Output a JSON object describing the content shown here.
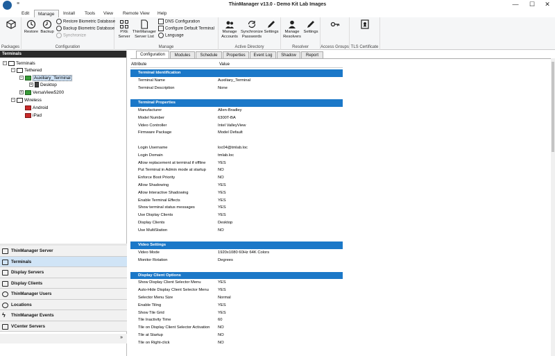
{
  "window": {
    "title": "ThinManager v13.0 - Demo Kit Lab Images",
    "quick_access": "≡",
    "min": "—",
    "max": "☐",
    "close": "✕"
  },
  "menu_tabs": [
    "Edit",
    "Manage",
    "Install",
    "Tools",
    "View",
    "Remote View",
    "Help"
  ],
  "ribbon": {
    "packages": {
      "group": "Packages"
    },
    "configuration": {
      "group": "Configuration",
      "restore": "Restore",
      "backup": "Backup",
      "restore_bio": "Restore Biometric Database",
      "backup_bio": "Backup Biometric Database",
      "synchronize": "Synchronize"
    },
    "manage": {
      "group": "Manage",
      "pxe": "PXE Server",
      "server_list": "ThinManager Server List",
      "dns": "DNS Configuration",
      "default_terminal": "Configure Default Terminal",
      "language": "Language"
    },
    "active_directory": {
      "group": "Active Directory",
      "manage_accounts": "Manage Accounts",
      "sync_passwords": "Synchronize Passwords",
      "settings": "Settings"
    },
    "resolver": {
      "group": "Resolver",
      "manage_resolvers": "Manage Resolvers",
      "settings": "Settings"
    },
    "access_groups": {
      "group": "Access Groups"
    },
    "tls": {
      "group": "TLS Certificate"
    }
  },
  "left_panel": {
    "header": "Terminals",
    "tree": {
      "root": "Terminals",
      "tethered": "Tethered",
      "auxiliary": "Auxiliary_Terminal",
      "desktop": "Desktop",
      "versaview": "VersaView5200",
      "wireless": "Wireless",
      "android": "Android",
      "ipad": "iPad"
    },
    "nav": [
      {
        "label": "ThinManager Server"
      },
      {
        "label": "Terminals"
      },
      {
        "label": "Display Servers"
      },
      {
        "label": "Display Clients"
      },
      {
        "label": "ThinManager Users"
      },
      {
        "label": "Locations"
      },
      {
        "label": "ThinManager Events"
      },
      {
        "label": "VCenter Servers"
      }
    ],
    "collapse": "»"
  },
  "tabs": [
    "Configuration",
    "Modules",
    "Schedule",
    "Properties",
    "Event Log",
    "Shadow",
    "Report"
  ],
  "grid": {
    "col_attribute": "Attribute",
    "col_value": "Value",
    "sections": [
      {
        "title": "Terminal Identification",
        "rows": [
          {
            "a": "Terminal Name",
            "v": "Auxiliary_Terminal"
          },
          {
            "a": "Terminal Description",
            "v": "None"
          },
          {
            "a": "",
            "v": ""
          }
        ]
      },
      {
        "title": "Terminal Properties",
        "rows": [
          {
            "a": "Manufacturer",
            "v": "Allen-Bradley"
          },
          {
            "a": "Model Number",
            "v": "6300T-BA"
          },
          {
            "a": "Video Controller",
            "v": "Intel ValleyView"
          },
          {
            "a": "Firmware Package",
            "v": "Model Default"
          },
          {
            "a": "",
            "v": ""
          },
          {
            "a": "Login Username",
            "v": "loc04@tmlab.loc"
          },
          {
            "a": "Login Domain",
            "v": "tmlab.loc"
          },
          {
            "a": "Allow replacement at terminal if offline",
            "v": "YES"
          },
          {
            "a": "Put Terminal in Admin mode at startup",
            "v": "NO"
          },
          {
            "a": "Enforce Boot Priority",
            "v": "NO"
          },
          {
            "a": "Allow Shadowing",
            "v": "YES"
          },
          {
            "a": "Allow Interactive Shadowing",
            "v": "YES"
          },
          {
            "a": "Enable Terminal Effects",
            "v": "YES"
          },
          {
            "a": "Show terminal status messages",
            "v": "YES"
          },
          {
            "a": "Use Display Clients",
            "v": "YES"
          },
          {
            "a": "Display Clients",
            "v": "Desktop"
          },
          {
            "a": "Use MultiStation",
            "v": "NO"
          },
          {
            "a": "",
            "v": ""
          }
        ]
      },
      {
        "title": "Video Settings",
        "rows": [
          {
            "a": "Video Mode",
            "v": "1920x1080 60Hz 64K Colors"
          },
          {
            "a": "Monitor Rotation",
            "v": " Degrees"
          },
          {
            "a": "",
            "v": ""
          }
        ]
      },
      {
        "title": "Display Client Options",
        "rows": [
          {
            "a": "Show Display Client Selector Menu",
            "v": "YES"
          },
          {
            "a": "Auto-Hide Display Client Selector Menu",
            "v": "YES"
          },
          {
            "a": "Selector Menu Size",
            "v": "Normal"
          },
          {
            "a": "Enable Tiling",
            "v": "YES"
          },
          {
            "a": "Show Tile Grid",
            "v": "YES"
          },
          {
            "a": "Tile Inactivity Time",
            "v": "60"
          },
          {
            "a": "Tile on Display Client Selector Activation",
            "v": "NO"
          },
          {
            "a": "Tile at Startup",
            "v": "NO"
          },
          {
            "a": "Tile on Right-click",
            "v": "NO"
          }
        ]
      }
    ]
  },
  "colors": {
    "section_header": "#1b78c8",
    "nav_active": "#d0e4f6",
    "terminal_online": "#3a9c3a",
    "terminal_offline": "#c92a2a"
  }
}
